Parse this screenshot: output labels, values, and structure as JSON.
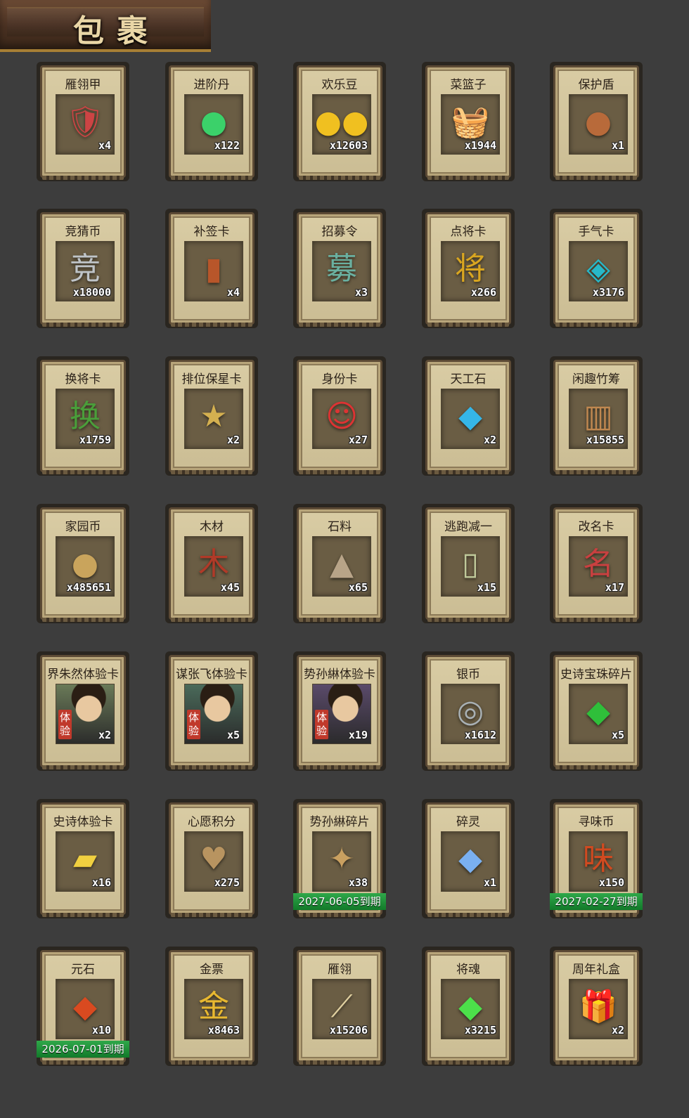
{
  "header": {
    "title": "包裹"
  },
  "items": [
    {
      "name": "雁翎甲",
      "count": "x4",
      "icon": "armor-icon",
      "glyph": "🛡",
      "color": "#c44"
    },
    {
      "name": "进阶丹",
      "count": "x122",
      "icon": "green-pill-icon",
      "glyph": "●",
      "color": "#3bd16a"
    },
    {
      "name": "欢乐豆",
      "count": "x12603",
      "icon": "gold-beans-icon",
      "glyph": "●●",
      "color": "#f0c020"
    },
    {
      "name": "菜篮子",
      "count": "x1944",
      "icon": "basket-icon",
      "glyph": "🧺",
      "color": "#c9a060"
    },
    {
      "name": "保护盾",
      "count": "x1",
      "icon": "round-shield-icon",
      "glyph": "●",
      "color": "#b86a3a"
    },
    {
      "name": "竞猜币",
      "count": "x18000",
      "icon": "silver-coin-icon",
      "glyph": "竞",
      "color": "#bfc4c8"
    },
    {
      "name": "补签卡",
      "count": "x4",
      "icon": "resign-card-icon",
      "glyph": "▮",
      "color": "#b8562a"
    },
    {
      "name": "招募令",
      "count": "x3",
      "icon": "recruit-token-icon",
      "glyph": "募",
      "color": "#6ab0a0"
    },
    {
      "name": "点将卡",
      "count": "x266",
      "icon": "general-card-icon",
      "glyph": "将",
      "color": "#d9a620"
    },
    {
      "name": "手气卡",
      "count": "x3176",
      "icon": "luck-card-icon",
      "glyph": "◈",
      "color": "#27b8c9"
    },
    {
      "name": "换将卡",
      "count": "x1759",
      "icon": "swap-general-card-icon",
      "glyph": "换",
      "color": "#4a9e3a"
    },
    {
      "name": "排位保星卡",
      "count": "x2",
      "icon": "rank-star-card-icon",
      "glyph": "★",
      "color": "#d4b050"
    },
    {
      "name": "身份卡",
      "count": "x27",
      "icon": "identity-card-icon",
      "glyph": "☺",
      "color": "#d33"
    },
    {
      "name": "天工石",
      "count": "x2",
      "icon": "blue-gem-icon",
      "glyph": "◆",
      "color": "#35b6e8"
    },
    {
      "name": "闲趣竹筹",
      "count": "x15855",
      "icon": "bamboo-token-icon",
      "glyph": "▥",
      "color": "#c08850"
    },
    {
      "name": "家园币",
      "count": "x485651",
      "icon": "home-coin-icon",
      "glyph": "●",
      "color": "#c9a45c"
    },
    {
      "name": "木材",
      "count": "x45",
      "icon": "wood-icon",
      "glyph": "木",
      "color": "#b03a28"
    },
    {
      "name": "石料",
      "count": "x65",
      "icon": "stone-icon",
      "glyph": "▲",
      "color": "#b8a488"
    },
    {
      "name": "逃跑减一",
      "count": "x15",
      "icon": "escape-tag-icon",
      "glyph": "▯",
      "color": "#bfc99a"
    },
    {
      "name": "改名卡",
      "count": "x17",
      "icon": "rename-card-icon",
      "glyph": "名",
      "color": "#c94040"
    },
    {
      "name": "界朱然体验卡",
      "count": "x2",
      "icon": "hero-portrait-icon",
      "glyph": "",
      "color": "#6a7a58",
      "trial": "体验"
    },
    {
      "name": "谋张飞体验卡",
      "count": "x5",
      "icon": "hero-portrait-icon",
      "glyph": "",
      "color": "#4a6a5a",
      "trial": "体验"
    },
    {
      "name": "势孙綝体验卡",
      "count": "x19",
      "icon": "hero-portrait-icon",
      "glyph": "",
      "color": "#5a4a6a",
      "trial": "体验"
    },
    {
      "name": "银币",
      "count": "x1612",
      "icon": "silver-coins-icon",
      "glyph": "◎",
      "color": "#a8b0b4"
    },
    {
      "name": "史诗宝珠碎片",
      "count": "x5",
      "icon": "green-fragment-icon",
      "glyph": "◆",
      "color": "#2fbf3a"
    },
    {
      "name": "史诗体验卡",
      "count": "x16",
      "icon": "gold-card-icon",
      "glyph": "▰",
      "color": "#f0d040"
    },
    {
      "name": "心愿积分",
      "count": "x275",
      "icon": "heart-coin-icon",
      "glyph": "♥",
      "color": "#b89460"
    },
    {
      "name": "势孙綝碎片",
      "count": "x38",
      "icon": "hero-fragment-icon",
      "glyph": "✦",
      "color": "#c9a060",
      "expiry": "2027-06-05到期"
    },
    {
      "name": "碎灵",
      "count": "x1",
      "icon": "crystal-shard-icon",
      "glyph": "◆",
      "color": "#7ab0f0"
    },
    {
      "name": "寻味币",
      "count": "x150",
      "icon": "taste-coin-icon",
      "glyph": "味",
      "color": "#d04a20",
      "expiry": "2027-02-27到期"
    },
    {
      "name": "元石",
      "count": "x10",
      "icon": "red-stone-icon",
      "glyph": "◆",
      "color": "#d94a20",
      "expiry": "2026-07-01到期"
    },
    {
      "name": "金票",
      "count": "x8463",
      "icon": "gold-ticket-icon",
      "glyph": "金",
      "color": "#e8b830"
    },
    {
      "name": "雁翎",
      "count": "x15206",
      "icon": "feather-icon",
      "glyph": "⟋",
      "color": "#e0d0a0"
    },
    {
      "name": "将魂",
      "count": "x3215",
      "icon": "green-soul-icon",
      "glyph": "◆",
      "color": "#4ce04a"
    },
    {
      "name": "周年礼盒",
      "count": "x2",
      "icon": "gift-box-icon",
      "glyph": "🎁",
      "color": "#d8d8d8"
    }
  ]
}
